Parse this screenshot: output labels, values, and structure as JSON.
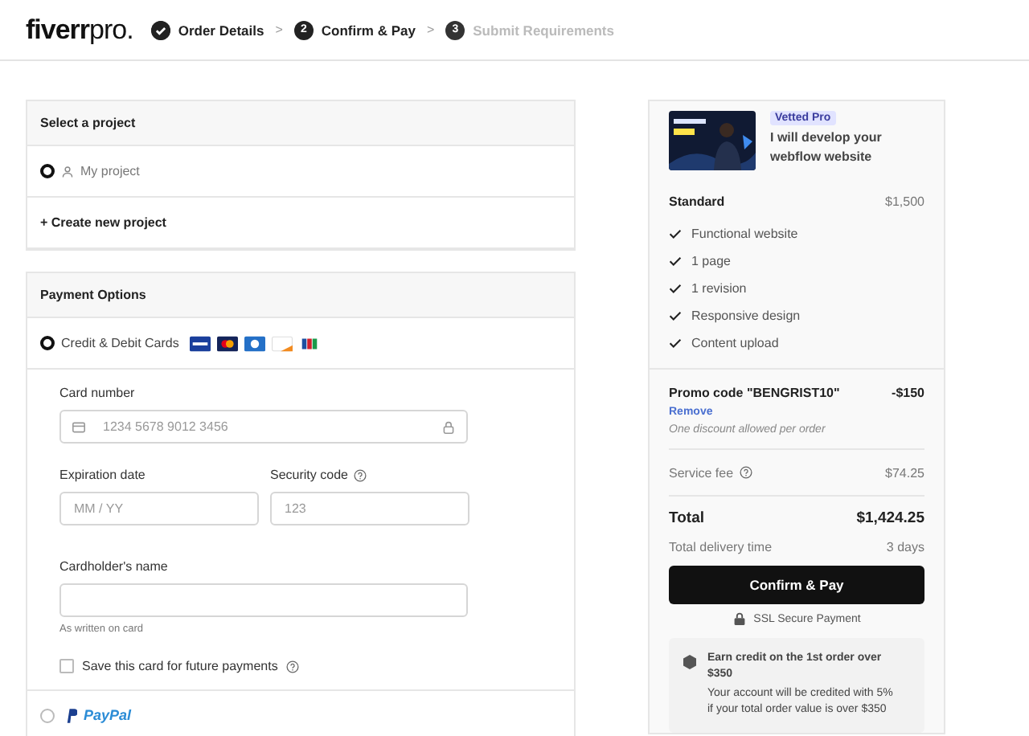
{
  "header": {
    "logo": "fiverr",
    "logo_suffix": "pro.",
    "separator": ">",
    "steps": [
      {
        "label": "Order Details",
        "completed": true,
        "disabled": false
      },
      {
        "number": "2",
        "label": "Confirm & Pay",
        "completed": false,
        "disabled": false
      },
      {
        "number": "3",
        "label": "Submit Requirements",
        "completed": false,
        "disabled": true
      }
    ]
  },
  "project": {
    "title": "Select a project",
    "options": [
      {
        "label": "My project",
        "selected": true
      }
    ],
    "create_link": "+ Create new project"
  },
  "payment": {
    "title": "Payment Options",
    "methods": [
      {
        "kind": "card",
        "label": "Credit & Debit Cards",
        "selected": true
      },
      {
        "kind": "paypal",
        "label": "PayPal",
        "selected": false
      }
    ],
    "card_number": {
      "label": "Card number",
      "placeholder": "1234 5678 9012 3456"
    },
    "expiration": {
      "label": "Expiration date",
      "placeholder": "MM / YY"
    },
    "security": {
      "label": "Security code",
      "placeholder": "123"
    },
    "cardholder": {
      "label": "Cardholder's name",
      "hint": "As written on card"
    },
    "save_card": {
      "label": "Save this card for future payments",
      "checked": false
    }
  },
  "summary": {
    "badge": "Vetted Pro",
    "gig_title": "I will develop your webflow website",
    "package": "Standard",
    "price": "$1,500",
    "features": [
      "Functional website",
      "1 page",
      "1 revision",
      "Responsive design",
      "Content upload"
    ],
    "promo_label": "Promo code \"BENGRIST10\"",
    "promo_amount": "-$150",
    "remove_link": "Remove",
    "promo_note": "One discount allowed per order",
    "service_fee_label": "Service fee",
    "service_fee": "$74.25",
    "total_label": "Total",
    "total": "$1,424.25",
    "delivery_label": "Total delivery time",
    "delivery": "3 days",
    "confirm_button": "Confirm & Pay",
    "ssl": "SSL Secure Payment",
    "credit_title": "Earn credit on the 1st order over $350",
    "credit_text": "Your account will be credited with 5% if your total order value is over $350"
  }
}
